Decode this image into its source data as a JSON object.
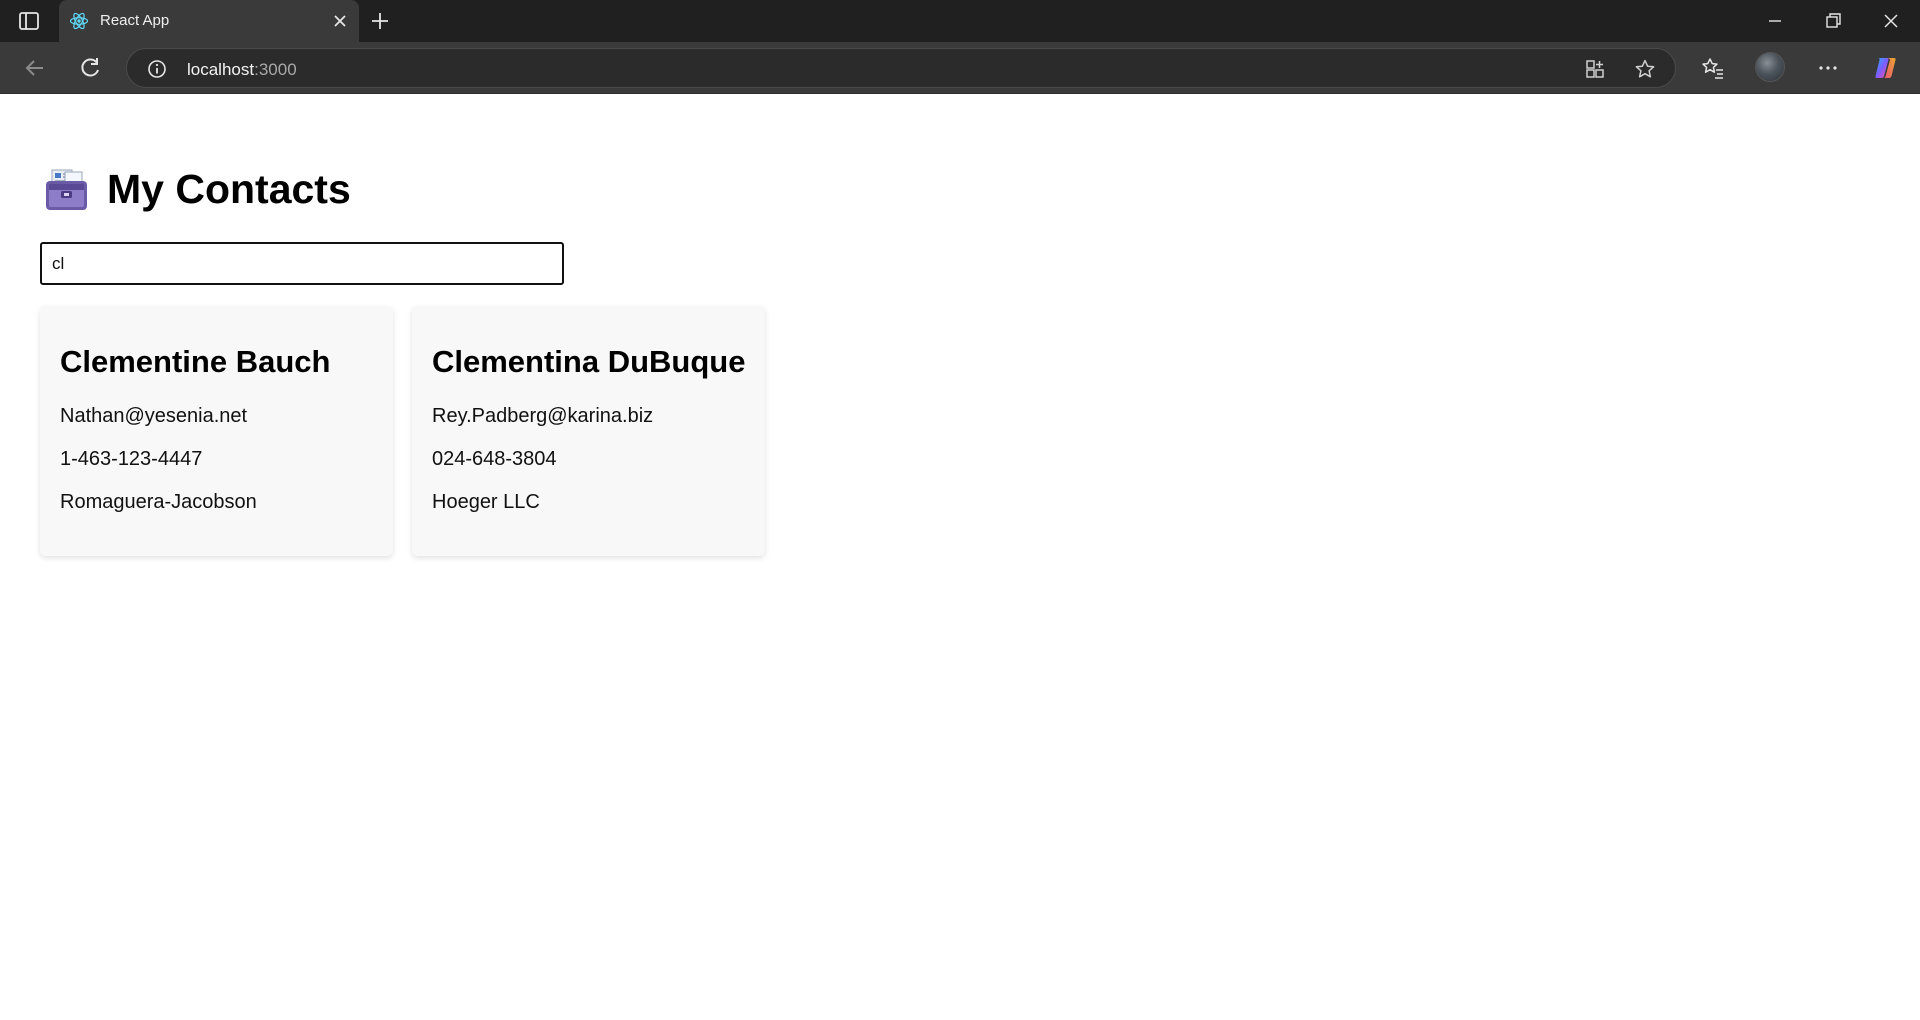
{
  "browser": {
    "tab_title": "React App",
    "url_host": "localhost",
    "url_port": ":3000",
    "icons": [
      "sidebar-toggle-icon",
      "react-favicon-icon",
      "close-icon",
      "plus-icon",
      "minimize-icon",
      "restore-icon",
      "close-window-icon",
      "back-icon",
      "refresh-icon",
      "info-icon",
      "app-grid-icon",
      "star-icon",
      "favorites-icon",
      "more-icon",
      "copilot-icon"
    ]
  },
  "page": {
    "title": "My Contacts",
    "header_icon": "card-file-box-icon",
    "search": {
      "value": "cl",
      "placeholder": ""
    },
    "contacts": [
      {
        "name": "Clementine Bauch",
        "email": "Nathan@yesenia.net",
        "phone": "1-463-123-4447",
        "company": "Romaguera-Jacobson"
      },
      {
        "name": "Clementina DuBuque",
        "email": "Rey.Padberg@karina.biz",
        "phone": "024-648-3804",
        "company": "Hoeger LLC"
      }
    ]
  },
  "colors": {
    "chrome_dark": "#202020",
    "chrome_mid": "#3a3a3a",
    "card_bg": "#f8f8f8",
    "text": "#000000"
  }
}
